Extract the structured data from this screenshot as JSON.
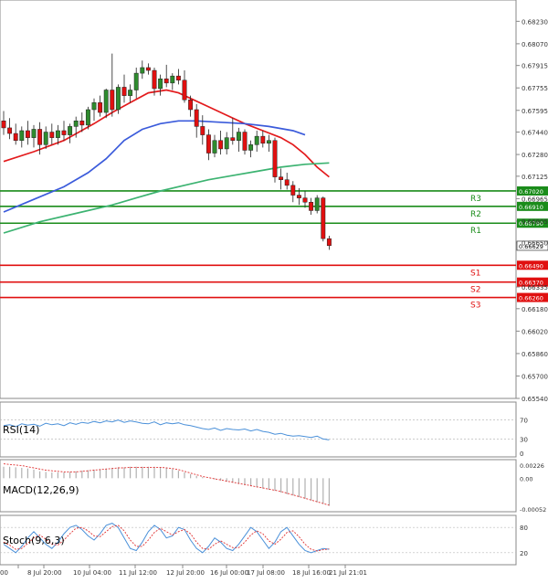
{
  "colors": {
    "bull_candle": "#2e8b2e",
    "bear_candle": "#e01010",
    "ma_fast": "#e31a1c",
    "ma_mid": "#3b5bdb",
    "ma_slow": "#3cb371",
    "resistance": "#1a8c1a",
    "support": "#e01010",
    "price_tag_bg": "#ffffff",
    "indicator_line": "#4a90d9",
    "indicator_signal": "#e03030",
    "macd_hist": "#b0b0b0",
    "grid": "#e9e9e9",
    "axis": "#888888"
  },
  "chart_data": {
    "type": "candlestick",
    "price_axis": {
      "range": [
        0.6554,
        0.6833
      ],
      "ticks": [
        "0.68230",
        "0.68070",
        "0.67915",
        "0.67755",
        "0.67595",
        "0.67440",
        "0.67280",
        "0.67125",
        "0.66965",
        "0.66805",
        "0.66650",
        "0.66335",
        "0.66180",
        "0.66020",
        "0.65860",
        "0.65700",
        "0.65540"
      ]
    },
    "time_axis": {
      "ticks": [
        "00",
        "8 Jul 20:00",
        "10 Jul 04:00",
        "11 Jul 12:00",
        "12 Jul 20:00",
        "16 Jul 00:00",
        "17 Jul 08:00",
        "18 Jul 16:00",
        "21 Jul 21:01"
      ]
    },
    "candles": [
      [
        0.6752,
        0.6759,
        0.6742,
        0.6747
      ],
      [
        0.6747,
        0.6754,
        0.6739,
        0.6743
      ],
      [
        0.6743,
        0.675,
        0.6735,
        0.6738
      ],
      [
        0.6738,
        0.6748,
        0.6733,
        0.6745
      ],
      [
        0.6745,
        0.6752,
        0.6735,
        0.674
      ],
      [
        0.674,
        0.6749,
        0.6733,
        0.6746
      ],
      [
        0.6746,
        0.6751,
        0.6728,
        0.6735
      ],
      [
        0.6735,
        0.6748,
        0.6732,
        0.6744
      ],
      [
        0.6744,
        0.675,
        0.6735,
        0.674
      ],
      [
        0.674,
        0.6749,
        0.6735,
        0.6745
      ],
      [
        0.6745,
        0.6752,
        0.6738,
        0.6742
      ],
      [
        0.6742,
        0.675,
        0.6736,
        0.6748
      ],
      [
        0.6748,
        0.6755,
        0.674,
        0.6752
      ],
      [
        0.6752,
        0.6758,
        0.6744,
        0.6749
      ],
      [
        0.6749,
        0.6762,
        0.6746,
        0.676
      ],
      [
        0.676,
        0.6768,
        0.6752,
        0.6765
      ],
      [
        0.6765,
        0.677,
        0.6755,
        0.6758
      ],
      [
        0.6758,
        0.6775,
        0.6754,
        0.6774
      ],
      [
        0.6774,
        0.68,
        0.6755,
        0.676
      ],
      [
        0.676,
        0.6778,
        0.6757,
        0.6776
      ],
      [
        0.6776,
        0.6785,
        0.6765,
        0.677
      ],
      [
        0.677,
        0.6778,
        0.6765,
        0.6774
      ],
      [
        0.6774,
        0.679,
        0.6768,
        0.6786
      ],
      [
        0.6786,
        0.6795,
        0.6782,
        0.679
      ],
      [
        0.679,
        0.6793,
        0.6785,
        0.6788
      ],
      [
        0.6788,
        0.679,
        0.677,
        0.6775
      ],
      [
        0.6775,
        0.6785,
        0.677,
        0.6782
      ],
      [
        0.6782,
        0.6792,
        0.6776,
        0.6779
      ],
      [
        0.6779,
        0.6786,
        0.6774,
        0.6784
      ],
      [
        0.6784,
        0.6789,
        0.6778,
        0.6781
      ],
      [
        0.6781,
        0.6788,
        0.6765,
        0.6767
      ],
      [
        0.6767,
        0.677,
        0.6755,
        0.676
      ],
      [
        0.676,
        0.6764,
        0.674,
        0.6748
      ],
      [
        0.6748,
        0.6756,
        0.6735,
        0.6742
      ],
      [
        0.6742,
        0.6746,
        0.6724,
        0.6729
      ],
      [
        0.6729,
        0.6742,
        0.6726,
        0.6738
      ],
      [
        0.6738,
        0.6745,
        0.6728,
        0.6732
      ],
      [
        0.6732,
        0.6744,
        0.6728,
        0.674
      ],
      [
        0.674,
        0.6754,
        0.6735,
        0.6738
      ],
      [
        0.6738,
        0.6747,
        0.673,
        0.6744
      ],
      [
        0.6744,
        0.6746,
        0.6728,
        0.6731
      ],
      [
        0.6731,
        0.6738,
        0.6726,
        0.6735
      ],
      [
        0.6735,
        0.6745,
        0.673,
        0.6741
      ],
      [
        0.6741,
        0.6745,
        0.6733,
        0.6736
      ],
      [
        0.6736,
        0.6742,
        0.673,
        0.6738
      ],
      [
        0.6738,
        0.674,
        0.6708,
        0.6712
      ],
      [
        0.6712,
        0.6718,
        0.6703,
        0.671
      ],
      [
        0.671,
        0.6715,
        0.6703,
        0.6706
      ],
      [
        0.6706,
        0.6709,
        0.6694,
        0.6699
      ],
      [
        0.6699,
        0.6704,
        0.6692,
        0.6697
      ],
      [
        0.6697,
        0.6702,
        0.669,
        0.6694
      ],
      [
        0.6694,
        0.6697,
        0.6685,
        0.6688
      ],
      [
        0.6688,
        0.6699,
        0.6686,
        0.6697
      ],
      [
        0.6697,
        0.6698,
        0.6666,
        0.6668
      ],
      [
        0.6668,
        0.667,
        0.666,
        0.6663
      ]
    ],
    "moving_averages": [
      {
        "role": "fast",
        "values": [
          [
            0,
            0.6723
          ],
          [
            5,
            0.673
          ],
          [
            10,
            0.6738
          ],
          [
            15,
            0.675
          ],
          [
            18,
            0.6758
          ],
          [
            21,
            0.6765
          ],
          [
            24,
            0.6772
          ],
          [
            27,
            0.6774
          ],
          [
            29,
            0.6772
          ],
          [
            31,
            0.6768
          ],
          [
            34,
            0.6762
          ],
          [
            37,
            0.6756
          ],
          [
            40,
            0.675
          ],
          [
            43,
            0.6745
          ],
          [
            46,
            0.674
          ],
          [
            48,
            0.6735
          ],
          [
            50,
            0.6728
          ],
          [
            52,
            0.6719
          ],
          [
            54,
            0.6712
          ]
        ]
      },
      {
        "role": "mid",
        "values": [
          [
            0,
            0.6687
          ],
          [
            5,
            0.6696
          ],
          [
            10,
            0.6705
          ],
          [
            14,
            0.6715
          ],
          [
            17,
            0.6725
          ],
          [
            20,
            0.6738
          ],
          [
            23,
            0.6746
          ],
          [
            26,
            0.675
          ],
          [
            29,
            0.6752
          ],
          [
            32,
            0.6752
          ],
          [
            36,
            0.6751
          ],
          [
            40,
            0.675
          ],
          [
            44,
            0.6748
          ],
          [
            48,
            0.6745
          ],
          [
            50,
            0.6742
          ]
        ]
      },
      {
        "role": "slow",
        "values": [
          [
            0,
            0.6672
          ],
          [
            6,
            0.668
          ],
          [
            12,
            0.6686
          ],
          [
            18,
            0.6692
          ],
          [
            22,
            0.6697
          ],
          [
            26,
            0.6702
          ],
          [
            30,
            0.6706
          ],
          [
            34,
            0.671
          ],
          [
            38,
            0.6713
          ],
          [
            42,
            0.6716
          ],
          [
            46,
            0.6719
          ],
          [
            50,
            0.6721
          ],
          [
            54,
            0.6722
          ]
        ]
      }
    ],
    "resistance_levels": [
      {
        "name": "R3",
        "value": 0.6702,
        "tag": "0.67020"
      },
      {
        "name": "R2",
        "value": 0.6691,
        "tag": "0.66910"
      },
      {
        "name": "R1",
        "value": 0.6679,
        "tag": "0.66790"
      }
    ],
    "support_levels": [
      {
        "name": "S1",
        "value": 0.6649,
        "tag": "0.66490"
      },
      {
        "name": "S2",
        "value": 0.6637,
        "tag": "0.66370"
      },
      {
        "name": "S3",
        "value": 0.6626,
        "tag": "0.66260"
      }
    ],
    "current_price": {
      "value": 0.66629,
      "tag": "0.66629"
    },
    "indicators": {
      "rsi": {
        "label": "RSI(14)",
        "range": [
          0,
          100
        ],
        "ticks": [
          "70",
          "30",
          "0"
        ],
        "levels": [
          70,
          30
        ],
        "values": [
          58,
          60,
          56,
          62,
          59,
          61,
          57,
          63,
          60,
          62,
          58,
          64,
          61,
          65,
          63,
          67,
          64,
          68,
          66,
          70,
          65,
          68,
          66,
          63,
          62,
          66,
          60,
          64,
          62,
          64,
          60,
          58,
          55,
          52,
          50,
          53,
          48,
          52,
          50,
          49,
          51,
          47,
          50,
          46,
          44,
          40,
          42,
          38,
          36,
          37,
          35,
          33,
          36,
          30,
          28
        ]
      },
      "macd": {
        "label": "MACD(12,26,9)",
        "range": [
          -0.00052,
          0.00026
        ],
        "ticks": [
          "0.00226",
          "0.00",
          "-0.00052"
        ],
        "histogram": [
          0.0002,
          0.0002,
          0.00019,
          0.00018,
          0.00017,
          0.00015,
          0.00012,
          0.00011,
          0.0001,
          0.0001,
          0.0001,
          0.00011,
          0.00012,
          0.00013,
          0.00014,
          0.00015,
          0.00016,
          0.00017,
          0.00018,
          0.00019,
          0.00019,
          0.0002,
          0.0002,
          0.0002,
          0.0002,
          0.0002,
          0.00019,
          0.00018,
          0.00016,
          0.00013,
          0.0001,
          7e-05,
          4e-05,
          2e-05,
          0.0,
          -2e-05,
          -4e-05,
          -6e-05,
          -8e-05,
          -0.0001,
          -0.00012,
          -0.00014,
          -0.00016,
          -0.00018,
          -0.0002,
          -0.00022,
          -0.00025,
          -0.00028,
          -0.0003,
          -0.00033,
          -0.00036,
          -0.00039,
          -0.00042,
          -0.00045,
          -0.00048
        ],
        "signal": [
          0.00025,
          0.00024,
          0.00023,
          0.00022,
          0.0002,
          0.00018,
          0.00016,
          0.00014,
          0.00013,
          0.00012,
          0.00011,
          0.00011,
          0.00011,
          0.00012,
          0.00013,
          0.00014,
          0.00015,
          0.00016,
          0.00017,
          0.00018,
          0.00018,
          0.00019,
          0.00019,
          0.00019,
          0.00019,
          0.00019,
          0.00019,
          0.00018,
          0.00017,
          0.00015,
          0.00012,
          9e-05,
          6e-05,
          3e-05,
          1e-05,
          -1e-05,
          -3e-05,
          -5e-05,
          -7e-05,
          -9e-05,
          -0.00011,
          -0.00013,
          -0.00015,
          -0.00017,
          -0.00019,
          -0.00021,
          -0.00023,
          -0.00026,
          -0.00029,
          -0.00032,
          -0.00035,
          -0.00038,
          -0.00041,
          -0.00044,
          -0.00047
        ]
      },
      "stoch": {
        "label": "Stoch(9,6,3)",
        "range": [
          0,
          100
        ],
        "ticks": [
          "80",
          "20"
        ],
        "levels": [
          80,
          20
        ],
        "k": [
          40,
          30,
          20,
          35,
          55,
          70,
          55,
          40,
          30,
          45,
          65,
          80,
          85,
          75,
          60,
          50,
          65,
          85,
          90,
          80,
          55,
          30,
          25,
          45,
          70,
          85,
          75,
          55,
          60,
          80,
          75,
          50,
          30,
          20,
          35,
          55,
          45,
          30,
          25,
          40,
          60,
          80,
          70,
          50,
          30,
          45,
          70,
          80,
          60,
          40,
          25,
          20,
          25,
          30,
          28
        ],
        "d": [
          45,
          38,
          28,
          30,
          42,
          55,
          62,
          52,
          40,
          38,
          50,
          65,
          78,
          80,
          72,
          60,
          58,
          70,
          82,
          85,
          72,
          50,
          35,
          35,
          50,
          68,
          78,
          70,
          62,
          70,
          75,
          65,
          45,
          30,
          28,
          40,
          48,
          40,
          32,
          32,
          45,
          62,
          72,
          65,
          48,
          40,
          52,
          68,
          72,
          58,
          40,
          28,
          24,
          27,
          29
        ]
      }
    }
  }
}
